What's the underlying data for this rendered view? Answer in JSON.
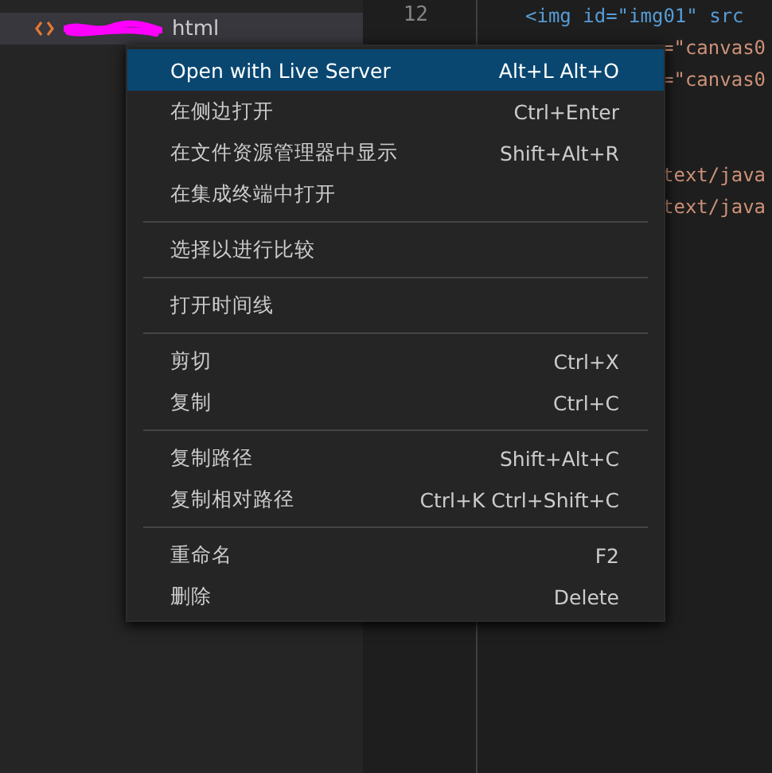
{
  "explorer": {
    "file": {
      "name": "html",
      "selected": true
    }
  },
  "editor": {
    "line_number": "12",
    "lines": [
      {
        "kind": "full",
        "text": "<img id=\"img01\" src"
      },
      {
        "kind": "tail",
        "text": "=\"canvas0"
      },
      {
        "kind": "tail",
        "text": "=\"canvas0"
      },
      {
        "kind": "blank"
      },
      {
        "kind": "blank"
      },
      {
        "kind": "tail",
        "text": "text/java"
      },
      {
        "kind": "tail",
        "text": "text/java"
      }
    ]
  },
  "context_menu": {
    "groups": [
      [
        {
          "label": "Open with Live Server",
          "shortcut": "Alt+L Alt+O",
          "selected": true
        },
        {
          "label": "在侧边打开",
          "shortcut": "Ctrl+Enter",
          "selected": false
        },
        {
          "label": "在文件资源管理器中显示",
          "shortcut": "Shift+Alt+R",
          "selected": false
        },
        {
          "label": "在集成终端中打开",
          "selected": false
        }
      ],
      [
        {
          "label": "选择以进行比较",
          "selected": false
        }
      ],
      [
        {
          "label": "打开时间线",
          "selected": false
        }
      ],
      [
        {
          "label": "剪切",
          "shortcut": "Ctrl+X",
          "selected": false
        },
        {
          "label": "复制",
          "shortcut": "Ctrl+C",
          "selected": false
        }
      ],
      [
        {
          "label": "复制路径",
          "shortcut": "Shift+Alt+C",
          "selected": false
        },
        {
          "label": "复制相对路径",
          "shortcut": "Ctrl+K Ctrl+Shift+C",
          "selected": false
        }
      ],
      [
        {
          "label": "重命名",
          "shortcut": "F2",
          "selected": false
        },
        {
          "label": "删除",
          "shortcut": "Delete",
          "selected": false
        }
      ]
    ]
  }
}
